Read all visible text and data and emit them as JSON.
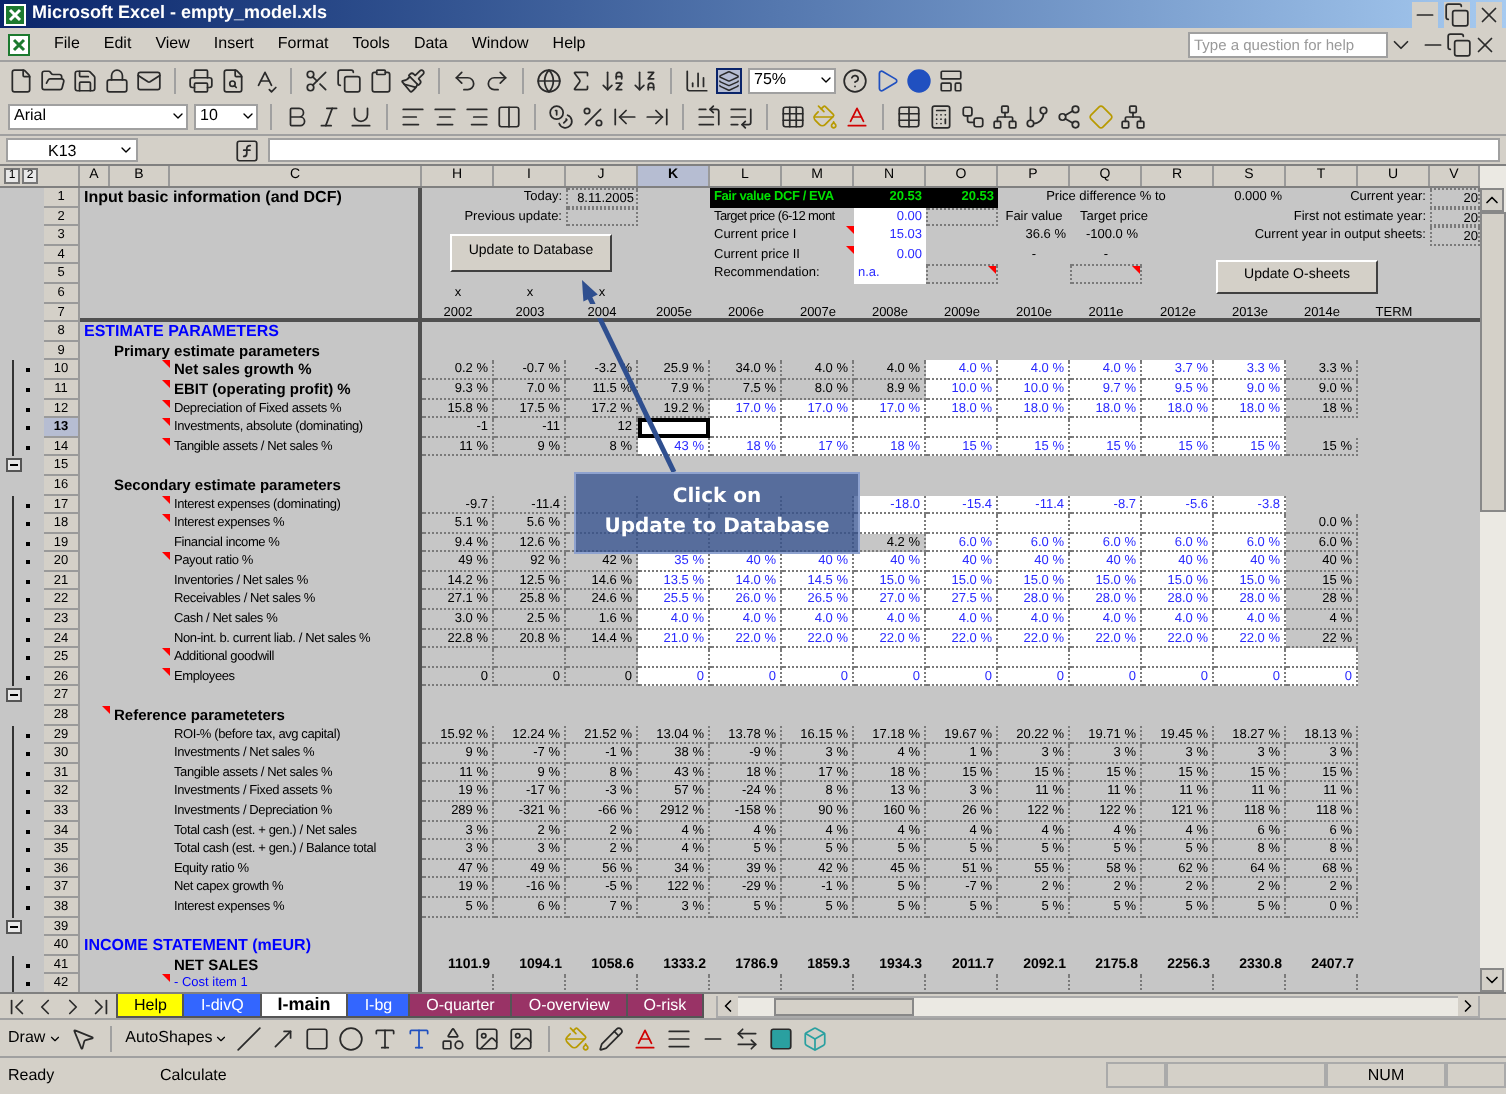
{
  "window": {
    "title": "Microsoft Excel - empty_model.xls"
  },
  "menu": [
    "File",
    "Edit",
    "View",
    "Insert",
    "Format",
    "Tools",
    "Data",
    "Window",
    "Help"
  ],
  "help_box": {
    "placeholder": "Type a question for help"
  },
  "toolbar": {
    "zoom": "75%",
    "font": "Arial",
    "size": "10"
  },
  "name_box": "K13",
  "outline_levels": [
    "1",
    "2"
  ],
  "columns": [
    {
      "label": "A",
      "selected": false
    },
    {
      "label": "B",
      "selected": false
    },
    {
      "label": "C",
      "selected": false
    },
    {
      "label": "H",
      "selected": false
    },
    {
      "label": "I",
      "selected": false
    },
    {
      "label": "J",
      "selected": false
    },
    {
      "label": "K",
      "selected": true
    },
    {
      "label": "L",
      "selected": false
    },
    {
      "label": "M",
      "selected": false
    },
    {
      "label": "N",
      "selected": false
    },
    {
      "label": "O",
      "selected": false
    },
    {
      "label": "P",
      "selected": false
    },
    {
      "label": "Q",
      "selected": false
    },
    {
      "label": "R",
      "selected": false
    },
    {
      "label": "S",
      "selected": false
    },
    {
      "label": "T",
      "selected": false
    },
    {
      "label": "U",
      "selected": false
    },
    {
      "label": "V",
      "selected": false
    }
  ],
  "top_row_numbers": [
    "1",
    "2",
    "3",
    "4",
    "5",
    "6",
    "7"
  ],
  "summary": {
    "title": "Input basic information (and DCF)",
    "today": {
      "label": "Today:",
      "value": "8.11.2005"
    },
    "previous_update": {
      "label": "Previous update:"
    },
    "fair_value": {
      "label": "Fair value DCF / EVA",
      "values": [
        "20.53",
        "20.53"
      ]
    },
    "target_price": {
      "label": "Target price (6-12 mont",
      "value": "0.00"
    },
    "current_price_1": {
      "label": "Current price I",
      "value": "15.03",
      "note": true
    },
    "current_price_2": {
      "label": "Current price II",
      "value": "0.00",
      "note": true
    },
    "recommendation": {
      "label": "Recommendation:",
      "value": "n.a.",
      "note": true
    },
    "price_difference": {
      "label": "Price difference % to",
      "value": "0.000 %",
      "headers": [
        "Fair value",
        "Target price"
      ],
      "values": [
        "36.6 %",
        "-100.0 %"
      ],
      "dashes": [
        "-",
        "-"
      ],
      "note": true
    },
    "years": [
      {
        "label": "Current year:",
        "value": "20"
      },
      {
        "label": "First not estimate year:",
        "value": "20"
      },
      {
        "label": "Current year in output sheets:",
        "value": "20"
      }
    ],
    "x_marks": [
      "x",
      "x",
      "x"
    ],
    "periods": [
      "2002",
      "2003",
      "2004",
      "2005e",
      "2006e",
      "2007e",
      "2008e",
      "2009e",
      "2010e",
      "2011e",
      "2012e",
      "2013e",
      "2014e",
      "TERM"
    ]
  },
  "buttons": [
    "Update to Database",
    "Update O-sheets"
  ],
  "callout": {
    "lines": [
      "Click on",
      "Update to Database"
    ]
  },
  "rows": [
    {
      "num": "8",
      "kind": "section",
      "label": "ESTIMATE PARAMETERS",
      "note": false,
      "selected": false,
      "grouped": false,
      "collapse": false
    },
    {
      "num": "9",
      "kind": "group",
      "label": "Primary estimate parameters",
      "note": false,
      "selected": false,
      "grouped": false,
      "collapse": false
    },
    {
      "num": "10",
      "kind": "key_item",
      "label": "Net sales growth %",
      "note": true,
      "selected": false,
      "grouped": true,
      "collapse": false,
      "cells": [
        {
          "v": "0.2 %",
          "input": false
        },
        {
          "v": "-0.7 %",
          "input": false
        },
        {
          "v": "-3.2 %",
          "input": false
        },
        {
          "v": "25.9 %",
          "input": false
        },
        {
          "v": "34.0 %",
          "input": false
        },
        {
          "v": "4.0 %",
          "input": false
        },
        {
          "v": "4.0 %",
          "input": false
        },
        {
          "v": "4.0 %",
          "input": true
        },
        {
          "v": "4.0 %",
          "input": true
        },
        {
          "v": "4.0 %",
          "input": true
        },
        {
          "v": "3.7 %",
          "input": true
        },
        {
          "v": "3.3 %",
          "input": true
        },
        {
          "v": "3.3 %",
          "input": false
        }
      ]
    },
    {
      "num": "11",
      "kind": "key_item",
      "label": "EBIT (operating profit) %",
      "note": true,
      "selected": false,
      "grouped": true,
      "collapse": false,
      "cells": [
        {
          "v": "9.3 %",
          "input": false
        },
        {
          "v": "7.0 %",
          "input": false
        },
        {
          "v": "11.5 %",
          "input": false
        },
        {
          "v": "7.9 %",
          "input": false
        },
        {
          "v": "7.5 %",
          "input": false
        },
        {
          "v": "8.0 %",
          "input": false
        },
        {
          "v": "8.9 %",
          "input": false
        },
        {
          "v": "10.0 %",
          "input": true
        },
        {
          "v": "10.0 %",
          "input": true
        },
        {
          "v": "9.7 %",
          "input": true
        },
        {
          "v": "9.5 %",
          "input": true
        },
        {
          "v": "9.0 %",
          "input": true
        },
        {
          "v": "9.0 %",
          "input": false
        }
      ]
    },
    {
      "num": "12",
      "kind": "item",
      "label": "Depreciation of Fixed assets %",
      "note": true,
      "selected": false,
      "grouped": true,
      "collapse": false,
      "cells": [
        {
          "v": "15.8 %",
          "input": false
        },
        {
          "v": "17.5 %",
          "input": false
        },
        {
          "v": "17.2 %",
          "input": false
        },
        {
          "v": "19.2 %",
          "input": false
        },
        {
          "v": "17.0 %",
          "input": true
        },
        {
          "v": "17.0 %",
          "input": true
        },
        {
          "v": "17.0 %",
          "input": true
        },
        {
          "v": "18.0 %",
          "input": true
        },
        {
          "v": "18.0 %",
          "input": true
        },
        {
          "v": "18.0 %",
          "input": true
        },
        {
          "v": "18.0 %",
          "input": true
        },
        {
          "v": "18.0 %",
          "input": true
        },
        {
          "v": "18 %",
          "input": false
        }
      ]
    },
    {
      "num": "13",
      "kind": "item",
      "label": "Investments, absolute (dominating)",
      "note": true,
      "selected": true,
      "grouped": true,
      "collapse": false,
      "cells": [
        {
          "v": "-1",
          "input": false
        },
        {
          "v": "-11",
          "input": false
        },
        {
          "v": "12",
          "input": false
        },
        {
          "input": true
        },
        {
          "input": true
        },
        {
          "input": true
        },
        {
          "input": true
        },
        {
          "input": true
        },
        {
          "input": true
        },
        {
          "input": true
        },
        {
          "input": true
        },
        {
          "input": true
        }
      ]
    },
    {
      "num": "14",
      "kind": "item",
      "label": "Tangible assets / Net sales %",
      "note": true,
      "selected": false,
      "grouped": true,
      "collapse": false,
      "cells": [
        {
          "v": "11 %",
          "input": false
        },
        {
          "v": "9 %",
          "input": false
        },
        {
          "v": "8 %",
          "input": false
        },
        {
          "v": "43 %",
          "input": true
        },
        {
          "v": "18 %",
          "input": true
        },
        {
          "v": "17 %",
          "input": true
        },
        {
          "v": "18 %",
          "input": true
        },
        {
          "v": "15 %",
          "input": true
        },
        {
          "v": "15 %",
          "input": true
        },
        {
          "v": "15 %",
          "input": true
        },
        {
          "v": "15 %",
          "input": true
        },
        {
          "v": "15 %",
          "input": true
        },
        {
          "v": "15 %",
          "input": false
        }
      ]
    },
    {
      "num": "15",
      "kind": "blank",
      "note": false,
      "selected": false,
      "grouped": false,
      "collapse": true
    },
    {
      "num": "16",
      "kind": "group",
      "label": "Secondary estimate parameters",
      "note": false,
      "selected": false,
      "grouped": false,
      "collapse": false
    },
    {
      "num": "17",
      "kind": "item",
      "label": "Interest expenses (dominating)",
      "note": true,
      "selected": false,
      "grouped": true,
      "collapse": false,
      "cells": [
        {
          "v": "-9.7",
          "input": false
        },
        {
          "v": "-11.4",
          "input": false
        },
        {
          "input": false
        },
        {
          "input": false
        },
        {
          "input": false
        },
        {
          "input": false
        },
        {
          "v": "-18.0",
          "input": true
        },
        {
          "v": "-15.4",
          "input": true
        },
        {
          "v": "-11.4",
          "input": true
        },
        {
          "v": "-8.7",
          "input": true
        },
        {
          "v": "-5.6",
          "input": true
        },
        {
          "v": "-3.8",
          "input": true
        }
      ]
    },
    {
      "num": "18",
      "kind": "item",
      "label": "Interest expenses %",
      "note": true,
      "selected": false,
      "grouped": true,
      "collapse": false,
      "cells": [
        {
          "v": "5.1 %",
          "input": false
        },
        {
          "v": "5.6 %",
          "input": false
        },
        {
          "input": false
        },
        {
          "input": false
        },
        {
          "input": false
        },
        {
          "input": false
        },
        {
          "input": true
        },
        {
          "input": true
        },
        {
          "input": true
        },
        {
          "input": true
        },
        {
          "input": true
        },
        {
          "input": true
        },
        {
          "v": "0.0 %",
          "input": false
        }
      ]
    },
    {
      "num": "19",
      "kind": "item",
      "label": "Financial income %",
      "note": false,
      "selected": false,
      "grouped": true,
      "collapse": false,
      "cells": [
        {
          "v": "9.4 %",
          "input": false
        },
        {
          "v": "12.6 %",
          "input": false
        },
        {
          "input": false
        },
        {
          "input": false
        },
        {
          "input": false
        },
        {
          "input": false
        },
        {
          "v": "4.2 %",
          "input": false
        },
        {
          "v": "6.0 %",
          "input": true
        },
        {
          "v": "6.0 %",
          "input": true
        },
        {
          "v": "6.0 %",
          "input": true
        },
        {
          "v": "6.0 %",
          "input": true
        },
        {
          "v": "6.0 %",
          "input": true
        },
        {
          "v": "6.0 %",
          "input": false
        }
      ]
    },
    {
      "num": "20",
      "kind": "item",
      "label": "Payout ratio %",
      "note": true,
      "selected": false,
      "grouped": true,
      "collapse": false,
      "cells": [
        {
          "v": "49 %",
          "input": false
        },
        {
          "v": "92 %",
          "input": false
        },
        {
          "v": "42 %",
          "input": false
        },
        {
          "v": "35 %",
          "input": true
        },
        {
          "v": "40 %",
          "input": true
        },
        {
          "v": "40 %",
          "input": true
        },
        {
          "v": "40 %",
          "input": true
        },
        {
          "v": "40 %",
          "input": true
        },
        {
          "v": "40 %",
          "input": true
        },
        {
          "v": "40 %",
          "input": true
        },
        {
          "v": "40 %",
          "input": true
        },
        {
          "v": "40 %",
          "input": true
        },
        {
          "v": "40 %",
          "input": false
        }
      ]
    },
    {
      "num": "21",
      "kind": "item",
      "label": "Inventories / Net sales %",
      "note": false,
      "selected": false,
      "grouped": true,
      "collapse": false,
      "cells": [
        {
          "v": "14.2 %",
          "input": false
        },
        {
          "v": "12.5 %",
          "input": false
        },
        {
          "v": "14.6 %",
          "input": false
        },
        {
          "v": "13.5 %",
          "input": true
        },
        {
          "v": "14.0 %",
          "input": true
        },
        {
          "v": "14.5 %",
          "input": true
        },
        {
          "v": "15.0 %",
          "input": true
        },
        {
          "v": "15.0 %",
          "input": true
        },
        {
          "v": "15.0 %",
          "input": true
        },
        {
          "v": "15.0 %",
          "input": true
        },
        {
          "v": "15.0 %",
          "input": true
        },
        {
          "v": "15.0 %",
          "input": true
        },
        {
          "v": "15 %",
          "input": false
        }
      ]
    },
    {
      "num": "22",
      "kind": "item",
      "label": "Receivables / Net sales %",
      "note": false,
      "selected": false,
      "grouped": true,
      "collapse": false,
      "cells": [
        {
          "v": "27.1 %",
          "input": false
        },
        {
          "v": "25.8 %",
          "input": false
        },
        {
          "v": "24.6 %",
          "input": false
        },
        {
          "v": "25.5 %",
          "input": true
        },
        {
          "v": "26.0 %",
          "input": true
        },
        {
          "v": "26.5 %",
          "input": true
        },
        {
          "v": "27.0 %",
          "input": true
        },
        {
          "v": "27.5 %",
          "input": true
        },
        {
          "v": "28.0 %",
          "input": true
        },
        {
          "v": "28.0 %",
          "input": true
        },
        {
          "v": "28.0 %",
          "input": true
        },
        {
          "v": "28.0 %",
          "input": true
        },
        {
          "v": "28 %",
          "input": false
        }
      ]
    },
    {
      "num": "23",
      "kind": "item",
      "label": "Cash / Net sales %",
      "note": false,
      "selected": false,
      "grouped": true,
      "collapse": false,
      "cells": [
        {
          "v": "3.0 %",
          "input": false
        },
        {
          "v": "2.5 %",
          "input": false
        },
        {
          "v": "1.6 %",
          "input": false
        },
        {
          "v": "4.0 %",
          "input": true
        },
        {
          "v": "4.0 %",
          "input": true
        },
        {
          "v": "4.0 %",
          "input": true
        },
        {
          "v": "4.0 %",
          "input": true
        },
        {
          "v": "4.0 %",
          "input": true
        },
        {
          "v": "4.0 %",
          "input": true
        },
        {
          "v": "4.0 %",
          "input": true
        },
        {
          "v": "4.0 %",
          "input": true
        },
        {
          "v": "4.0 %",
          "input": true
        },
        {
          "v": "4 %",
          "input": false
        }
      ]
    },
    {
      "num": "24",
      "kind": "item",
      "label": "Non-int. b. current liab. / Net sales %",
      "note": false,
      "selected": false,
      "grouped": true,
      "collapse": false,
      "cells": [
        {
          "v": "22.8 %",
          "input": false
        },
        {
          "v": "20.8 %",
          "input": false
        },
        {
          "v": "14.4 %",
          "input": false
        },
        {
          "v": "21.0 %",
          "input": true
        },
        {
          "v": "22.0 %",
          "input": true
        },
        {
          "v": "22.0 %",
          "input": true
        },
        {
          "v": "22.0 %",
          "input": true
        },
        {
          "v": "22.0 %",
          "input": true
        },
        {
          "v": "22.0 %",
          "input": true
        },
        {
          "v": "22.0 %",
          "input": true
        },
        {
          "v": "22.0 %",
          "input": true
        },
        {
          "v": "22.0 %",
          "input": true
        },
        {
          "v": "22 %",
          "input": false
        }
      ]
    },
    {
      "num": "25",
      "kind": "item",
      "label": "Additional goodwill",
      "note": true,
      "selected": false,
      "grouped": true,
      "collapse": false,
      "cells": [
        {
          "input": false
        },
        {
          "input": false
        },
        {
          "input": false
        },
        {
          "input": true
        },
        {
          "input": true
        },
        {
          "input": true
        },
        {
          "input": true
        },
        {
          "input": true
        },
        {
          "input": true
        },
        {
          "input": true
        },
        {
          "input": true
        },
        {
          "input": true
        },
        {
          "input": true
        }
      ]
    },
    {
      "num": "26",
      "kind": "item",
      "label": "Employees",
      "note": true,
      "selected": false,
      "grouped": true,
      "collapse": false,
      "cells": [
        {
          "v": "0",
          "input": false
        },
        {
          "v": "0",
          "input": false
        },
        {
          "v": "0",
          "input": false
        },
        {
          "v": "0",
          "input": true
        },
        {
          "v": "0",
          "input": true
        },
        {
          "v": "0",
          "input": true
        },
        {
          "v": "0",
          "input": true
        },
        {
          "v": "0",
          "input": true
        },
        {
          "v": "0",
          "input": true
        },
        {
          "v": "0",
          "input": true
        },
        {
          "v": "0",
          "input": true
        },
        {
          "v": "0",
          "input": true
        },
        {
          "v": "0",
          "input": true
        }
      ]
    },
    {
      "num": "27",
      "kind": "blank",
      "note": false,
      "selected": false,
      "grouped": false,
      "collapse": true
    },
    {
      "num": "28",
      "kind": "group",
      "label": "Reference parameteters",
      "note": true,
      "selected": false,
      "grouped": false,
      "collapse": false
    },
    {
      "num": "29",
      "kind": "item",
      "label": "ROI-% (before tax, avg capital)",
      "note": false,
      "selected": false,
      "grouped": true,
      "collapse": false,
      "cells": [
        {
          "v": "15.92 %",
          "input": false
        },
        {
          "v": "12.24 %",
          "input": false
        },
        {
          "v": "21.52 %",
          "input": false
        },
        {
          "v": "13.04 %",
          "input": false
        },
        {
          "v": "13.78 %",
          "input": false
        },
        {
          "v": "16.15 %",
          "input": false
        },
        {
          "v": "17.18 %",
          "input": false
        },
        {
          "v": "19.67 %",
          "input": false
        },
        {
          "v": "20.22 %",
          "input": false
        },
        {
          "v": "19.71 %",
          "input": false
        },
        {
          "v": "19.45 %",
          "input": false
        },
        {
          "v": "18.27 %",
          "input": false
        },
        {
          "v": "18.13 %",
          "input": false
        }
      ]
    },
    {
      "num": "30",
      "kind": "item",
      "label": "Investments / Net sales %",
      "note": false,
      "selected": false,
      "grouped": true,
      "collapse": false,
      "cells": [
        {
          "v": "9 %",
          "input": false
        },
        {
          "v": "-7 %",
          "input": false
        },
        {
          "v": "-1 %",
          "input": false
        },
        {
          "v": "38 %",
          "input": false
        },
        {
          "v": "-9 %",
          "input": false
        },
        {
          "v": "3 %",
          "input": false
        },
        {
          "v": "4 %",
          "input": false
        },
        {
          "v": "1 %",
          "input": false
        },
        {
          "v": "3 %",
          "input": false
        },
        {
          "v": "3 %",
          "input": false
        },
        {
          "v": "3 %",
          "input": false
        },
        {
          "v": "3 %",
          "input": false
        },
        {
          "v": "3 %",
          "input": false
        }
      ]
    },
    {
      "num": "31",
      "kind": "item",
      "label": "Tangible assets / Net sales %",
      "note": false,
      "selected": false,
      "grouped": true,
      "collapse": false,
      "cells": [
        {
          "v": "11 %",
          "input": false
        },
        {
          "v": "9 %",
          "input": false
        },
        {
          "v": "8 %",
          "input": false
        },
        {
          "v": "43 %",
          "input": false
        },
        {
          "v": "18 %",
          "input": false
        },
        {
          "v": "17 %",
          "input": false
        },
        {
          "v": "18 %",
          "input": false
        },
        {
          "v": "15 %",
          "input": false
        },
        {
          "v": "15 %",
          "input": false
        },
        {
          "v": "15 %",
          "input": false
        },
        {
          "v": "15 %",
          "input": false
        },
        {
          "v": "15 %",
          "input": false
        },
        {
          "v": "15 %",
          "input": false
        }
      ]
    },
    {
      "num": "32",
      "kind": "item",
      "label": "Investments / Fixed assets %",
      "note": false,
      "selected": false,
      "grouped": true,
      "collapse": false,
      "cells": [
        {
          "v": "19 %",
          "input": false
        },
        {
          "v": "-17 %",
          "input": false
        },
        {
          "v": "-3 %",
          "input": false
        },
        {
          "v": "57 %",
          "input": false
        },
        {
          "v": "-24 %",
          "input": false
        },
        {
          "v": "8 %",
          "input": false
        },
        {
          "v": "13 %",
          "input": false
        },
        {
          "v": "3 %",
          "input": false
        },
        {
          "v": "11 %",
          "input": false
        },
        {
          "v": "11 %",
          "input": false
        },
        {
          "v": "11 %",
          "input": false
        },
        {
          "v": "11 %",
          "input": false
        },
        {
          "v": "11 %",
          "input": false
        }
      ]
    },
    {
      "num": "33",
      "kind": "item",
      "label": "Investments / Depreciation %",
      "note": false,
      "selected": false,
      "grouped": true,
      "collapse": false,
      "cells": [
        {
          "v": "289 %",
          "input": false
        },
        {
          "v": "-321 %",
          "input": false
        },
        {
          "v": "-66 %",
          "input": false
        },
        {
          "v": "2912 %",
          "input": false
        },
        {
          "v": "-158 %",
          "input": false
        },
        {
          "v": "90 %",
          "input": false
        },
        {
          "v": "160 %",
          "input": false
        },
        {
          "v": "26 %",
          "input": false
        },
        {
          "v": "122 %",
          "input": false
        },
        {
          "v": "122 %",
          "input": false
        },
        {
          "v": "121 %",
          "input": false
        },
        {
          "v": "118 %",
          "input": false
        },
        {
          "v": "118 %",
          "input": false
        }
      ]
    },
    {
      "num": "34",
      "kind": "item",
      "label": "Total cash (est. + gen.) / Net sales",
      "note": false,
      "selected": false,
      "grouped": true,
      "collapse": false,
      "cells": [
        {
          "v": "3 %",
          "input": false
        },
        {
          "v": "2 %",
          "input": false
        },
        {
          "v": "2 %",
          "input": false
        },
        {
          "v": "4 %",
          "input": false
        },
        {
          "v": "4 %",
          "input": false
        },
        {
          "v": "4 %",
          "input": false
        },
        {
          "v": "4 %",
          "input": false
        },
        {
          "v": "4 %",
          "input": false
        },
        {
          "v": "4 %",
          "input": false
        },
        {
          "v": "4 %",
          "input": false
        },
        {
          "v": "4 %",
          "input": false
        },
        {
          "v": "6 %",
          "input": false
        },
        {
          "v": "6 %",
          "input": false
        }
      ]
    },
    {
      "num": "35",
      "kind": "item",
      "label": "Total cash (est. + gen.) / Balance total",
      "note": false,
      "selected": false,
      "grouped": true,
      "collapse": false,
      "cells": [
        {
          "v": "3 %",
          "input": false
        },
        {
          "v": "3 %",
          "input": false
        },
        {
          "v": "2 %",
          "input": false
        },
        {
          "v": "4 %",
          "input": false
        },
        {
          "v": "5 %",
          "input": false
        },
        {
          "v": "5 %",
          "input": false
        },
        {
          "v": "5 %",
          "input": false
        },
        {
          "v": "5 %",
          "input": false
        },
        {
          "v": "5 %",
          "input": false
        },
        {
          "v": "5 %",
          "input": false
        },
        {
          "v": "5 %",
          "input": false
        },
        {
          "v": "8 %",
          "input": false
        },
        {
          "v": "8 %",
          "input": false
        }
      ]
    },
    {
      "num": "36",
      "kind": "item",
      "label": "Equity ratio %",
      "note": false,
      "selected": false,
      "grouped": true,
      "collapse": false,
      "cells": [
        {
          "v": "47 %",
          "input": false
        },
        {
          "v": "49 %",
          "input": false
        },
        {
          "v": "56 %",
          "input": false
        },
        {
          "v": "34 %",
          "input": false
        },
        {
          "v": "39 %",
          "input": false
        },
        {
          "v": "42 %",
          "input": false
        },
        {
          "v": "45 %",
          "input": false
        },
        {
          "v": "51 %",
          "input": false
        },
        {
          "v": "55 %",
          "input": false
        },
        {
          "v": "58 %",
          "input": false
        },
        {
          "v": "62 %",
          "input": false
        },
        {
          "v": "64 %",
          "input": false
        },
        {
          "v": "68 %",
          "input": false
        }
      ]
    },
    {
      "num": "37",
      "kind": "item",
      "label": "Net capex growth %",
      "note": false,
      "selected": false,
      "grouped": true,
      "collapse": false,
      "cells": [
        {
          "v": "19 %",
          "input": false
        },
        {
          "v": "-16 %",
          "input": false
        },
        {
          "v": "-5 %",
          "input": false
        },
        {
          "v": "122 %",
          "input": false
        },
        {
          "v": "-29 %",
          "input": false
        },
        {
          "v": "-1 %",
          "input": false
        },
        {
          "v": "5 %",
          "input": false
        },
        {
          "v": "-7 %",
          "input": false
        },
        {
          "v": "2 %",
          "input": false
        },
        {
          "v": "2 %",
          "input": false
        },
        {
          "v": "2 %",
          "input": false
        },
        {
          "v": "2 %",
          "input": false
        },
        {
          "v": "2 %",
          "input": false
        }
      ]
    },
    {
      "num": "38",
      "kind": "item",
      "label": "Interest expenses %",
      "note": false,
      "selected": false,
      "grouped": true,
      "collapse": false,
      "cells": [
        {
          "v": "5 %",
          "input": false
        },
        {
          "v": "6 %",
          "input": false
        },
        {
          "v": "7 %",
          "input": false
        },
        {
          "v": "3 %",
          "input": false
        },
        {
          "v": "5 %",
          "input": false
        },
        {
          "v": "5 %",
          "input": false
        },
        {
          "v": "5 %",
          "input": false
        },
        {
          "v": "5 %",
          "input": false
        },
        {
          "v": "5 %",
          "input": false
        },
        {
          "v": "5 %",
          "input": false
        },
        {
          "v": "5 %",
          "input": false
        },
        {
          "v": "5 %",
          "input": false
        },
        {
          "v": "0 %",
          "input": false
        }
      ]
    },
    {
      "num": "39",
      "kind": "blank",
      "note": false,
      "selected": false,
      "grouped": false,
      "collapse": true
    },
    {
      "num": "40",
      "kind": "section",
      "label": "INCOME STATEMENT (mEUR)",
      "note": false,
      "selected": false,
      "grouped": false,
      "collapse": false
    },
    {
      "num": "41",
      "kind": "total",
      "label": "NET SALES",
      "note": false,
      "selected": false,
      "grouped": true,
      "collapse": false,
      "cells": [
        {
          "v": "1101.9",
          "input": false
        },
        {
          "v": "1094.1",
          "input": false
        },
        {
          "v": "1058.6",
          "input": false
        },
        {
          "v": "1333.2",
          "input": false
        },
        {
          "v": "1786.9",
          "input": false
        },
        {
          "v": "1859.3",
          "input": false
        },
        {
          "v": "1934.3",
          "input": false
        },
        {
          "v": "2011.7",
          "input": false
        },
        {
          "v": "2092.1",
          "input": false
        },
        {
          "v": "2175.8",
          "input": false
        },
        {
          "v": "2256.3",
          "input": false
        },
        {
          "v": "2330.8",
          "input": false
        },
        {
          "v": "2407.7",
          "input": false
        }
      ]
    },
    {
      "num": "42",
      "kind": "sub_item",
      "label": "- Cost item 1",
      "note": true,
      "selected": false,
      "grouped": true,
      "collapse": false,
      "cells": [
        {
          "input": false
        },
        {
          "input": false
        },
        {
          "input": false
        },
        {
          "input": false
        },
        {
          "input": false
        },
        {
          "input": false
        },
        {
          "input": false
        },
        {
          "input": false
        },
        {
          "input": false
        },
        {
          "input": false
        },
        {
          "input": false
        },
        {
          "input": false
        },
        {
          "input": false
        }
      ]
    }
  ],
  "sheet_tabs": [
    {
      "label": "Help",
      "color": "#ffff00",
      "selected": false
    },
    {
      "label": "I-divQ",
      "color": "#3366ff",
      "selected": false
    },
    {
      "label": "I-main",
      "color": "#ffffff",
      "selected": true
    },
    {
      "label": "I-bg",
      "color": "#3366ff",
      "selected": false
    },
    {
      "label": "O-quarter",
      "color": "#993366",
      "selected": false
    },
    {
      "label": "O-overview",
      "color": "#993366",
      "selected": false
    },
    {
      "label": "O-risk",
      "color": "#993366",
      "selected": false
    }
  ],
  "draw_toolbar": {
    "draw": "Draw",
    "autoshapes": "AutoShapes"
  },
  "status_bar": {
    "mode": "Ready",
    "calc": "Calculate",
    "num": "NUM"
  }
}
